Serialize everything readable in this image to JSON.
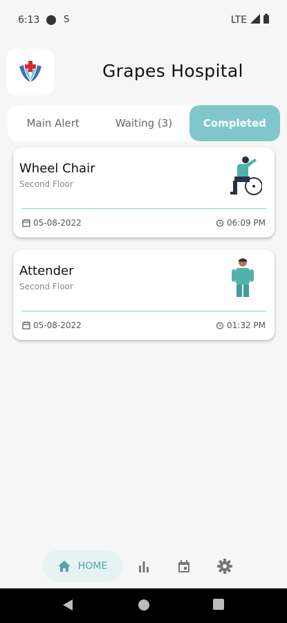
{
  "status_bar": {
    "time": "6:13",
    "network": "LTE"
  },
  "header": {
    "title": "Grapes Hospital"
  },
  "tabs": [
    {
      "label": "Main Alert"
    },
    {
      "label": "Waiting (3)"
    },
    {
      "label": "Completed"
    }
  ],
  "cards": [
    {
      "name": "Wheel Chair",
      "floor": "Second Floor",
      "date": "05-08-2022",
      "time": "06:09 PM",
      "icon": "wheelchair-illustration"
    },
    {
      "name": "Attender",
      "floor": "Second Floor",
      "date": "05-08-2022",
      "time": "01:32 PM",
      "icon": "attender-illustration"
    }
  ],
  "bottom_nav": {
    "home_label": "HOME"
  },
  "colors": {
    "accent": "#7fc7cc",
    "nav_accent": "#4fa6a6",
    "divider": "#8fcfd3"
  }
}
